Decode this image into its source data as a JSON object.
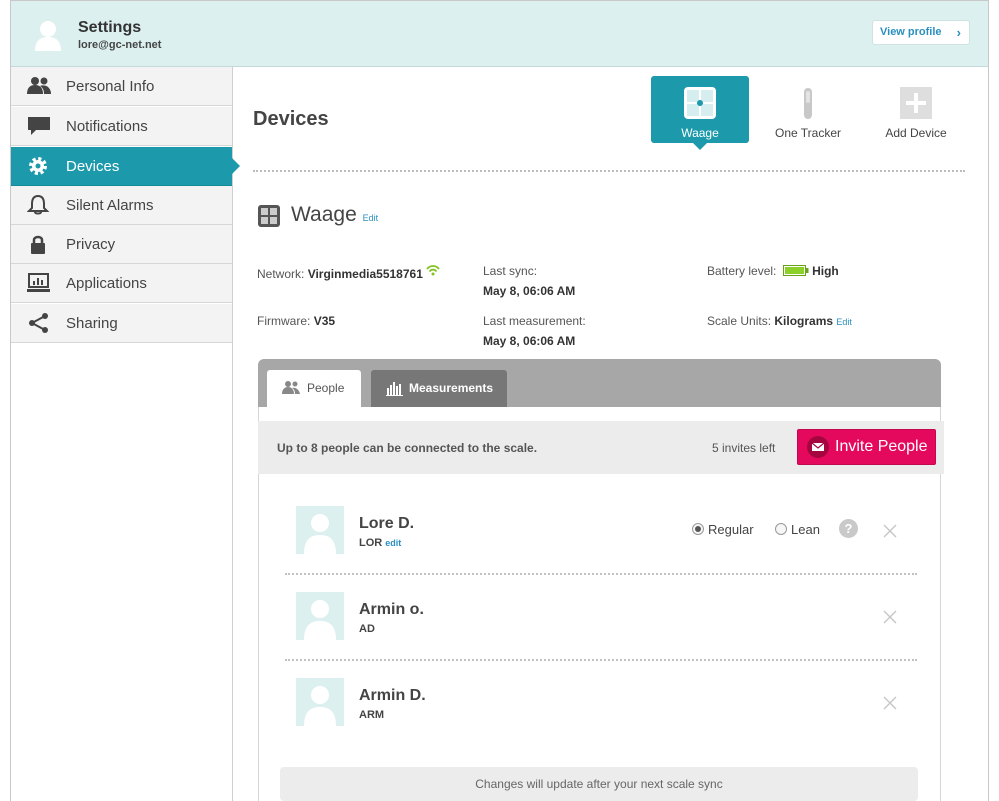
{
  "header": {
    "title": "Settings",
    "email": "lore@gc-net.net",
    "view_profile": "View profile",
    "avatar_icon": "user-avatar-icon"
  },
  "sidebar": {
    "items": [
      {
        "label": "Personal Info",
        "icon": "people-icon"
      },
      {
        "label": "Notifications",
        "icon": "speech-bubble-icon"
      },
      {
        "label": "Devices",
        "icon": "gear-icon",
        "active": true
      },
      {
        "label": "Silent Alarms",
        "icon": "bell-icon"
      },
      {
        "label": "Privacy",
        "icon": "lock-icon"
      },
      {
        "label": "Applications",
        "icon": "monitor-chart-icon"
      },
      {
        "label": "Sharing",
        "icon": "share-icon"
      }
    ]
  },
  "main": {
    "title": "Devices",
    "device_tabs": [
      {
        "label": "Waage",
        "icon": "scale-icon",
        "active": true
      },
      {
        "label": "One Tracker",
        "icon": "tracker-icon"
      },
      {
        "label": "Add Device",
        "icon": "plus-icon"
      }
    ],
    "device": {
      "name": "Waage",
      "edit": "Edit",
      "network_label": "Network:",
      "network_value": "Virginmedia5518761",
      "last_sync_label": "Last sync:",
      "last_sync_value": "May 8, 06:06 AM",
      "battery_label": "Battery level:",
      "battery_value": "High",
      "firmware_label": "Firmware:",
      "firmware_value": "V35",
      "last_measurement_label": "Last measurement:",
      "last_measurement_value": "May 8, 06:06 AM",
      "scale_units_label": "Scale Units:",
      "scale_units_value": "Kilograms",
      "scale_units_edit": "Edit"
    },
    "panel": {
      "tabs": [
        {
          "label": "People",
          "active": true
        },
        {
          "label": "Measurements"
        }
      ],
      "invite_text": "Up to 8 people can be connected to the scale.",
      "invites_left": "5 invites left",
      "invite_button": "Invite People",
      "people": [
        {
          "name": "Lore D.",
          "short": "LOR",
          "edit": "edit",
          "mode_regular": "Regular",
          "mode_lean": "Lean",
          "selected_mode": "Regular",
          "help": "?"
        },
        {
          "name": "Armin o.",
          "short": "AD"
        },
        {
          "name": "Armin D.",
          "short": "ARM"
        }
      ],
      "notice": "Changes will update after your next scale sync"
    }
  },
  "colors": {
    "accent": "#1c9aab",
    "invite": "#e5095d",
    "header_bg": "#dcf0f0",
    "link": "#2a8fbf"
  }
}
